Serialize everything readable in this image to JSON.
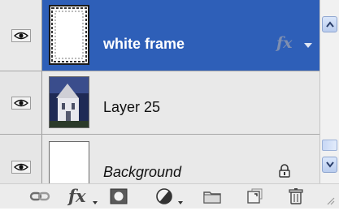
{
  "layers": [
    {
      "name": "white frame",
      "selected": true,
      "visible": true,
      "has_effects": true,
      "effects_badge": "fx",
      "locked": false
    },
    {
      "name": "Layer 25",
      "selected": false,
      "visible": true,
      "has_effects": false,
      "locked": false
    },
    {
      "name": "Background",
      "selected": false,
      "visible": true,
      "has_effects": false,
      "locked": true
    }
  ],
  "toolbar": {
    "fx_label": "fx"
  },
  "colors": {
    "selection": "#2e5fb8",
    "row_background": "#e9e9e9",
    "toolbar_background": "#ececec"
  },
  "icons": {
    "visibility": "eye-icon",
    "lock": "lock-icon",
    "link": "link-icon",
    "layer_style": "fx-icon",
    "mask": "layer-mask-icon",
    "adjustment": "adjustment-layer-icon",
    "group": "folder-icon",
    "new_layer": "new-layer-icon",
    "delete": "trash-icon"
  }
}
